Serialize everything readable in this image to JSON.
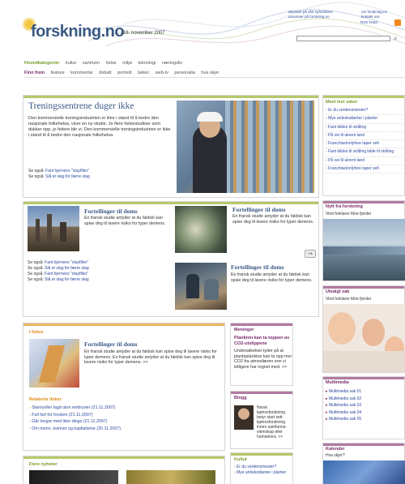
{
  "header": {
    "logo_text": "forskning.no",
    "date": "16. november 2007",
    "links_col1": [
      "abonner på vårt nyhetsbrev",
      "annonser på forskning.no"
    ],
    "links_col2": [
      "om forskning.no",
      "kontakt oss"
    ],
    "rss_label": "RSS Feed"
  },
  "nav": {
    "row1_label": "Hovedkategorier",
    "row1": [
      "kultur",
      "samfunn",
      "helse",
      "miljø",
      "teknologi",
      "næringsliv"
    ],
    "row2_label": "Finn frem",
    "row2": [
      "feature",
      "kommentar",
      "debatt",
      "portrett",
      "bøker",
      "web-tv",
      "personalia",
      "hva skjer"
    ]
  },
  "lead": {
    "title": "Treningssentrene duger ikke",
    "text": "Den kommersielle treningsindustrien er ikke i stand til å bedre den nasjonale folkehelsa, viser en ny studie. Jo flere helsestudioer som dukker opp, jo feitere blir vi. Den kommersielle treningsindustrien er ikke i stand til å bedre den nasjonale folkehelsa.",
    "seealso_prefix": "Se også:",
    "seealso": [
      "Fant hjernens \"stayfilter\"",
      "Slå et slag for færre slag"
    ]
  },
  "articles": {
    "a1_title": "Fortellinger til doms",
    "a1_text": "En fransk studie antyder at du faktisk kan spise deg til lavere risiko for typer demens.",
    "a1_see": [
      "Fant hjernens \"stayfilter\"",
      "Slå et slag for færre slag",
      "Fant hjernens \"stayfilter\"",
      "Slå et slag for færre slag"
    ],
    "a2_title": "Fortellinger til doms",
    "a2_text": "En fransk studie antyder at du faktisk kan spise deg til lavere risiko for typer demens.",
    "a3_title": "Fortellinger til doms",
    "a3_text": "En fransk studie antyder at du faktisk kan spise deg til lavere risiko for typer demens."
  },
  "fokus": {
    "head": "I fokus",
    "title": "Fortellinger til doms",
    "text": "En fransk studie antyder at du faktisk kan spise deg til lavere risiko for typer demens. En fransk studie antyder at du faktisk kan spise deg til lavere risiko for typer demens. >>",
    "related_head": "Relaterte linker",
    "related": [
      "Stamceller lagd uten embryoer (21.11.2007)",
      "Full fart for forsken (21.11.2007)",
      "Går lengre med liten dings (21.11.2007)",
      "Om menn, kvinner og kapitalisme (20.11.2007)"
    ]
  },
  "mening": {
    "head": "Meninger",
    "title": "Plankton kan ta toppen av CO2-utslippene",
    "text": "Undersøkelser tyder på at planteplankton kan ta opp mer CO2 fra atmosfæren enn vi tidligere har regnet med. >>"
  },
  "blogg": {
    "head": "Blogg",
    "text": "Norsk kjønnsforskning betyr stort sett kjønnsforskning innen samfunns-vitenskap eller humaniora. >>"
  },
  "kultur": {
    "head": "Kultur",
    "items": [
      "Er du verdensmester?",
      "Mye antioksidanter i planter"
    ]
  },
  "flere": {
    "head": "Flere nyheter"
  },
  "right": {
    "mest_lest_head": "Mest lest saker",
    "mest_lest": [
      "Er du verdensmester?",
      "Mye antioksidanter i planter",
      "Fant kilden til stråling",
      "På vei til ukrent land",
      "Franchiseinnlyfere taper seh",
      "Fant kilden til stråling kilde til stråling",
      "På vei til ukrent land",
      "Franchiseinnlyfere taper seh"
    ],
    "nytt_head": "Nytt fra forskning",
    "nytt_sub": "Vind forklarer fdrie fjorder",
    "utvalgt_head": "Utvalgt sak",
    "utvalgt_sub": "Vind forklarer fdrie fjorder",
    "multimedia_head": "Multimedia",
    "multimedia": [
      "Multimedia sak 01",
      "Multimedia sak 02",
      "Multimedia sak 03",
      "Multimedia sak 04",
      "Multimedia sak 05"
    ],
    "kalender_head": "Kalender",
    "kalender_sub": "Hva skjer?"
  },
  "colors": {
    "green": "#7a9a2a",
    "purple": "#7a2a6a",
    "orange": "#e08a18",
    "blue": "#3a5a86"
  }
}
